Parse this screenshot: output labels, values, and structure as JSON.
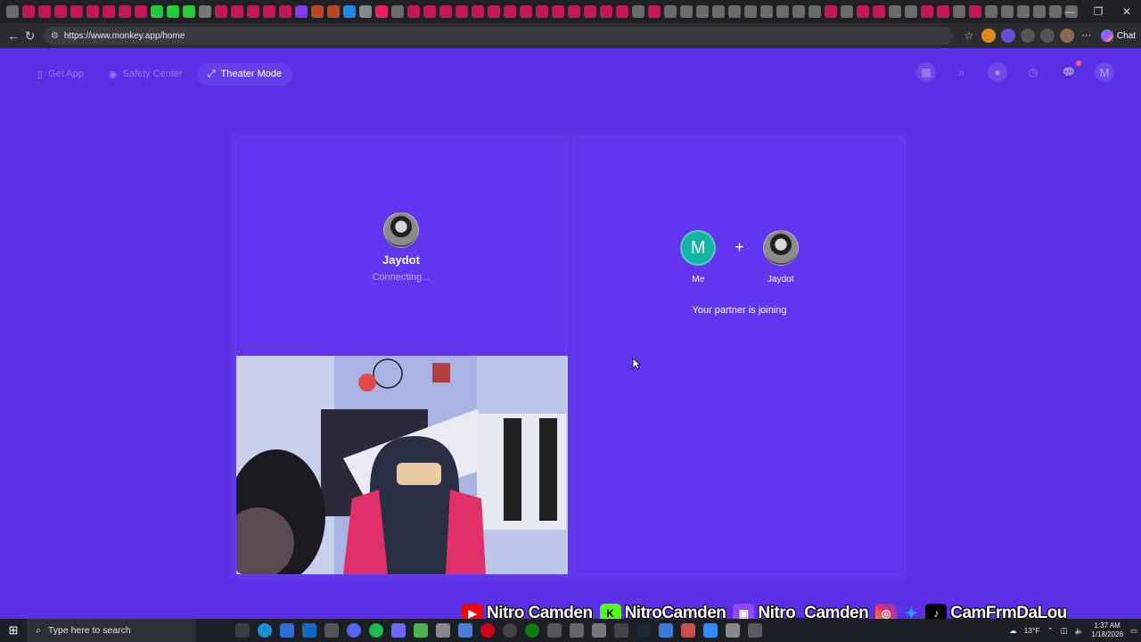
{
  "browser": {
    "url": "https://www.monkey.app/home",
    "chat_label": "Chat",
    "tab_colors": [
      "#6b6b6b",
      "#c2185b",
      "#c2185b",
      "#c2185b",
      "#c2185b",
      "#c2185b",
      "#c2185b",
      "#c2185b",
      "#c2185b",
      "#27c93f",
      "#27c93f",
      "#27c93f",
      "#777",
      "#c2185b",
      "#c2185b",
      "#c2185b",
      "#c2185b",
      "#c2185b",
      "#7b3fe4",
      "#b7472a",
      "#b7472a",
      "#1e88e5",
      "#888",
      "#e91e63",
      "#6b6b6b",
      "#c2185b",
      "#c2185b",
      "#c2185b",
      "#c2185b",
      "#c2185b",
      "#c2185b",
      "#c2185b",
      "#c2185b",
      "#c2185b",
      "#c2185b",
      "#c2185b",
      "#c2185b",
      "#c2185b",
      "#c2185b",
      "#6b6b6b",
      "#c2185b",
      "#6b6b6b",
      "#6b6b6b",
      "#6b6b6b",
      "#6b6b6b",
      "#6b6b6b",
      "#6b6b6b",
      "#6b6b6b",
      "#6b6b6b",
      "#6b6b6b",
      "#6b6b6b",
      "#c2185b",
      "#6b6b6b",
      "#c2185b",
      "#c2185b",
      "#6b6b6b",
      "#6b6b6b",
      "#c2185b",
      "#c2185b",
      "#6b6b6b",
      "#c2185b",
      "#6b6b6b",
      "#6b6b6b",
      "#6b6b6b",
      "#6b6b6b",
      "#6b6b6b",
      "#6b6b6b"
    ]
  },
  "header": {
    "get_app": "Get App",
    "safety_center": "Safety Center",
    "theater_mode": "Theater Mode",
    "user_initial": "M"
  },
  "left_panel": {
    "remote_name": "Jaydot",
    "remote_status": "Connecting..."
  },
  "right_panel": {
    "me_initial": "M",
    "me_label": "Me",
    "plus": "+",
    "partner_label": "Jaydot",
    "message": "Your partner is joining"
  },
  "overlay": {
    "youtube": "Nitro Camden",
    "kick": "NitroCamden",
    "twitch": "Nitro_Camden",
    "socials": "CamFrmDaLou"
  },
  "taskbar": {
    "search_placeholder": "Type here to search",
    "weather": "13°F",
    "time": "1:37 AM",
    "date": "1/18/2026"
  }
}
